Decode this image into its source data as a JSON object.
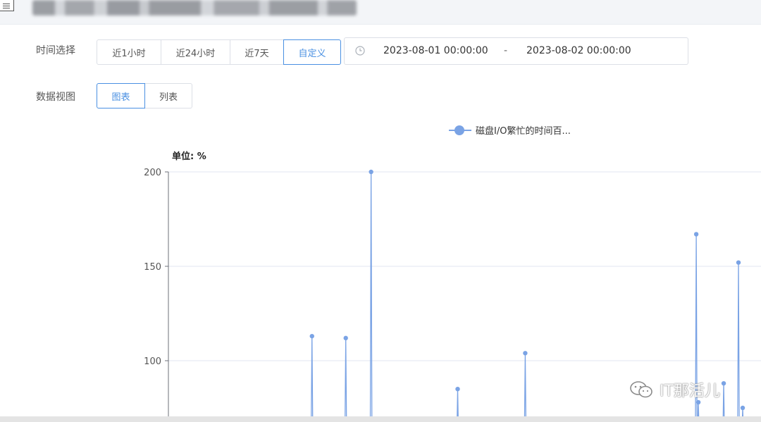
{
  "header": {
    "title_text": ""
  },
  "time_filter": {
    "label": "时间选择",
    "options": [
      "近1小时",
      "近24小时",
      "近7天",
      "自定义"
    ],
    "selected": "自定义",
    "range_start": "2023-08-01 00:00:00",
    "range_separator": "-",
    "range_end": "2023-08-02 00:00:00"
  },
  "view_filter": {
    "label": "数据视图",
    "options": [
      "图表",
      "列表"
    ],
    "selected": "图表"
  },
  "accent_color": "#4a90e2",
  "chart_data": {
    "type": "line",
    "series": [
      {
        "name": "磁盘I/O繁忙的时间百...",
        "color": "#7aa3e5",
        "spikes": [
          {
            "index": 68,
            "value": 113
          },
          {
            "index": 84,
            "value": 112
          },
          {
            "index": 96,
            "value": 200
          },
          {
            "index": 137,
            "value": 85
          },
          {
            "index": 169,
            "value": 104
          },
          {
            "index": 250,
            "value": 167
          },
          {
            "index": 251,
            "value": 78
          },
          {
            "index": 263,
            "value": 88
          },
          {
            "index": 270,
            "value": 152
          },
          {
            "index": 272,
            "value": 75
          }
        ]
      }
    ],
    "unit_label": "单位: %",
    "y_ticks": [
      100,
      150,
      200
    ],
    "ylim_visible": [
      70,
      200
    ],
    "x_range_indices": [
      0,
      280
    ],
    "grid": true,
    "legend_position": "top-center"
  },
  "watermark": {
    "text": "IT那活儿",
    "icon": "wechat-icon"
  }
}
